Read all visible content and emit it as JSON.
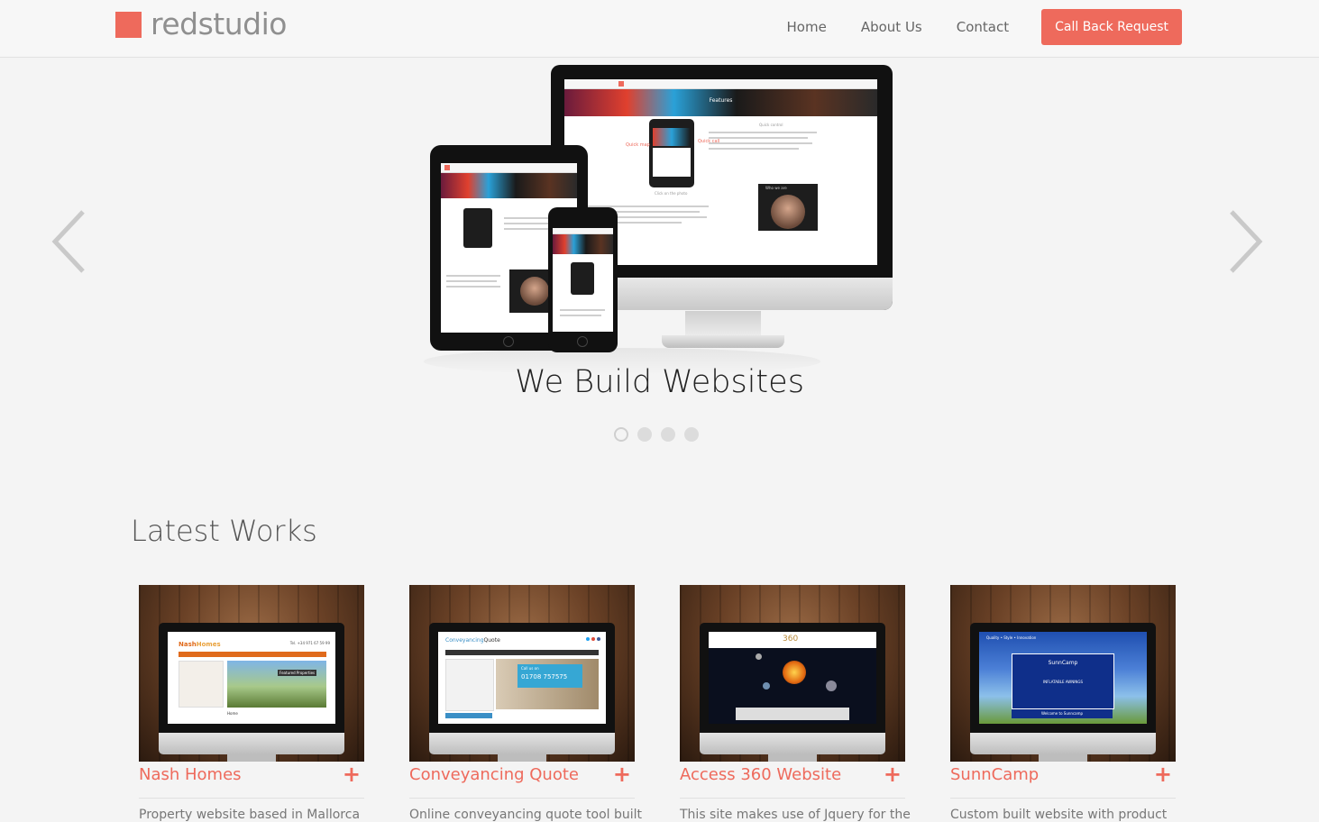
{
  "nav": {
    "brand": "redstudio",
    "links": [
      "Home",
      "About Us",
      "Contact"
    ],
    "cta": "Call Back Request"
  },
  "hero": {
    "title": "We Build Websites",
    "slides_count": 4,
    "active_slide": 1,
    "mockup": {
      "banner": "Features",
      "quick_map": "Quick map",
      "quick_call": "Quick call",
      "quick_control": "Quick control",
      "where_we_work": "Where we work",
      "click_photo": "Click on the photo",
      "who_we_are": "Who we are"
    }
  },
  "works": {
    "title": "Latest Works",
    "items": [
      {
        "title": "Nash Homes",
        "desc": "Property website based in Mallorca",
        "thumb": {
          "logo_a": "Nash",
          "logo_b": "Homes",
          "phone": "Tel. +34 971 67 59 99",
          "caption": "Home",
          "badge": "Featured Properties"
        }
      },
      {
        "title": "Conveyancing Quote",
        "desc": "Online conveyancing quote tool built",
        "thumb": {
          "logo_a": "Conveyancing",
          "logo_b": "Quote",
          "call_label": "Call us on",
          "phone": "01708 757575"
        }
      },
      {
        "title": "Access 360 Website",
        "desc": "This site makes use of Jquery for the",
        "thumb": {
          "logo": "360"
        }
      },
      {
        "title": "SunnCamp",
        "desc": "Custom built website with product",
        "thumb": {
          "tag": "Quality • Style • Innovation",
          "logo": "SunnCamp",
          "banner": "INFLATABLE AWNINGS",
          "welcome": "Welcome to Sunncamp"
        }
      }
    ]
  },
  "colors": {
    "accent": "#ee6a5c",
    "background": "#f4f4f4"
  }
}
